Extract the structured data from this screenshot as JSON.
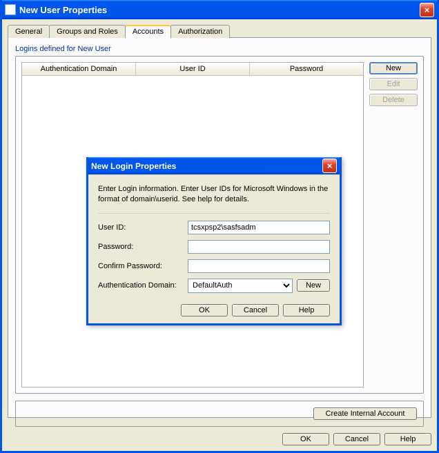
{
  "outer": {
    "title": "New User Properties",
    "close": "×",
    "tabs": {
      "general": "General",
      "groups": "Groups and Roles",
      "accounts": "Accounts",
      "auth": "Authorization"
    },
    "fieldset_label": "Logins defined for New User",
    "columns": {
      "auth_domain": "Authentication Domain",
      "user_id": "User ID",
      "password": "Password"
    },
    "side": {
      "new": "New",
      "edit": "Edit",
      "delete": "Delete"
    },
    "create_internal": "Create Internal Account",
    "buttons": {
      "ok": "OK",
      "cancel": "Cancel",
      "help": "Help"
    }
  },
  "modal": {
    "title": "New Login Properties",
    "close": "×",
    "instruction": "Enter Login information. Enter User IDs for Microsoft Windows in the format of domain\\userid. See help for details.",
    "labels": {
      "user_id": "User ID:",
      "password": "Password:",
      "confirm": "Confirm Password:",
      "auth_domain": "Authentication Domain:"
    },
    "values": {
      "user_id": "tcsxpsp2\\sasfsadm",
      "password": "",
      "confirm": "",
      "auth_domain": "DefaultAuth"
    },
    "new_btn": "New",
    "buttons": {
      "ok": "OK",
      "cancel": "Cancel",
      "help": "Help"
    }
  }
}
